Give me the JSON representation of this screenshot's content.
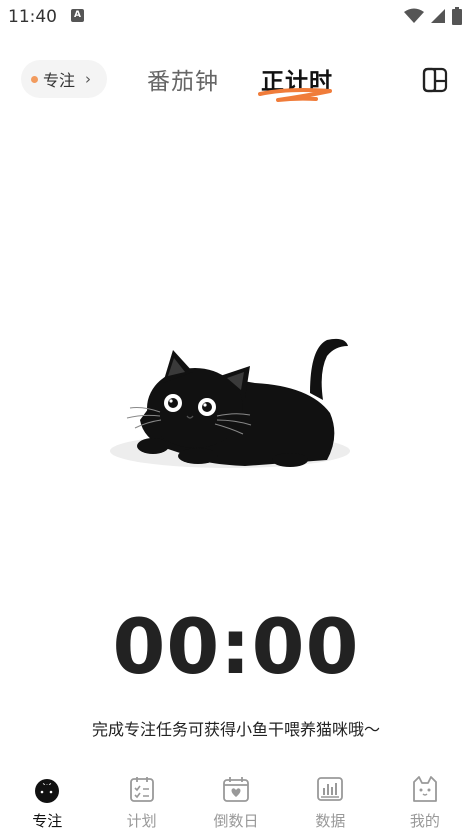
{
  "status_bar": {
    "time": "11:40",
    "notification_icon": "A"
  },
  "top_nav": {
    "focus_pill": {
      "label": "专注",
      "dot_color": "#f29b5e"
    },
    "tabs": [
      {
        "label": "番茄钟",
        "active": false
      },
      {
        "label": "正计时",
        "active": true
      }
    ],
    "accent": "#f07c3a"
  },
  "timer": {
    "display": "00:00"
  },
  "hint": "完成专注任务可获得小鱼干喂养猫咪哦～",
  "bottom_nav": {
    "items": [
      {
        "label": "专注",
        "icon": "tomato-icon",
        "active": true
      },
      {
        "label": "计划",
        "icon": "checklist-icon",
        "active": false
      },
      {
        "label": "倒数日",
        "icon": "calendar-heart-icon",
        "active": false
      },
      {
        "label": "数据",
        "icon": "bar-chart-icon",
        "active": false
      },
      {
        "label": "我的",
        "icon": "cat-face-icon",
        "active": false
      }
    ]
  }
}
